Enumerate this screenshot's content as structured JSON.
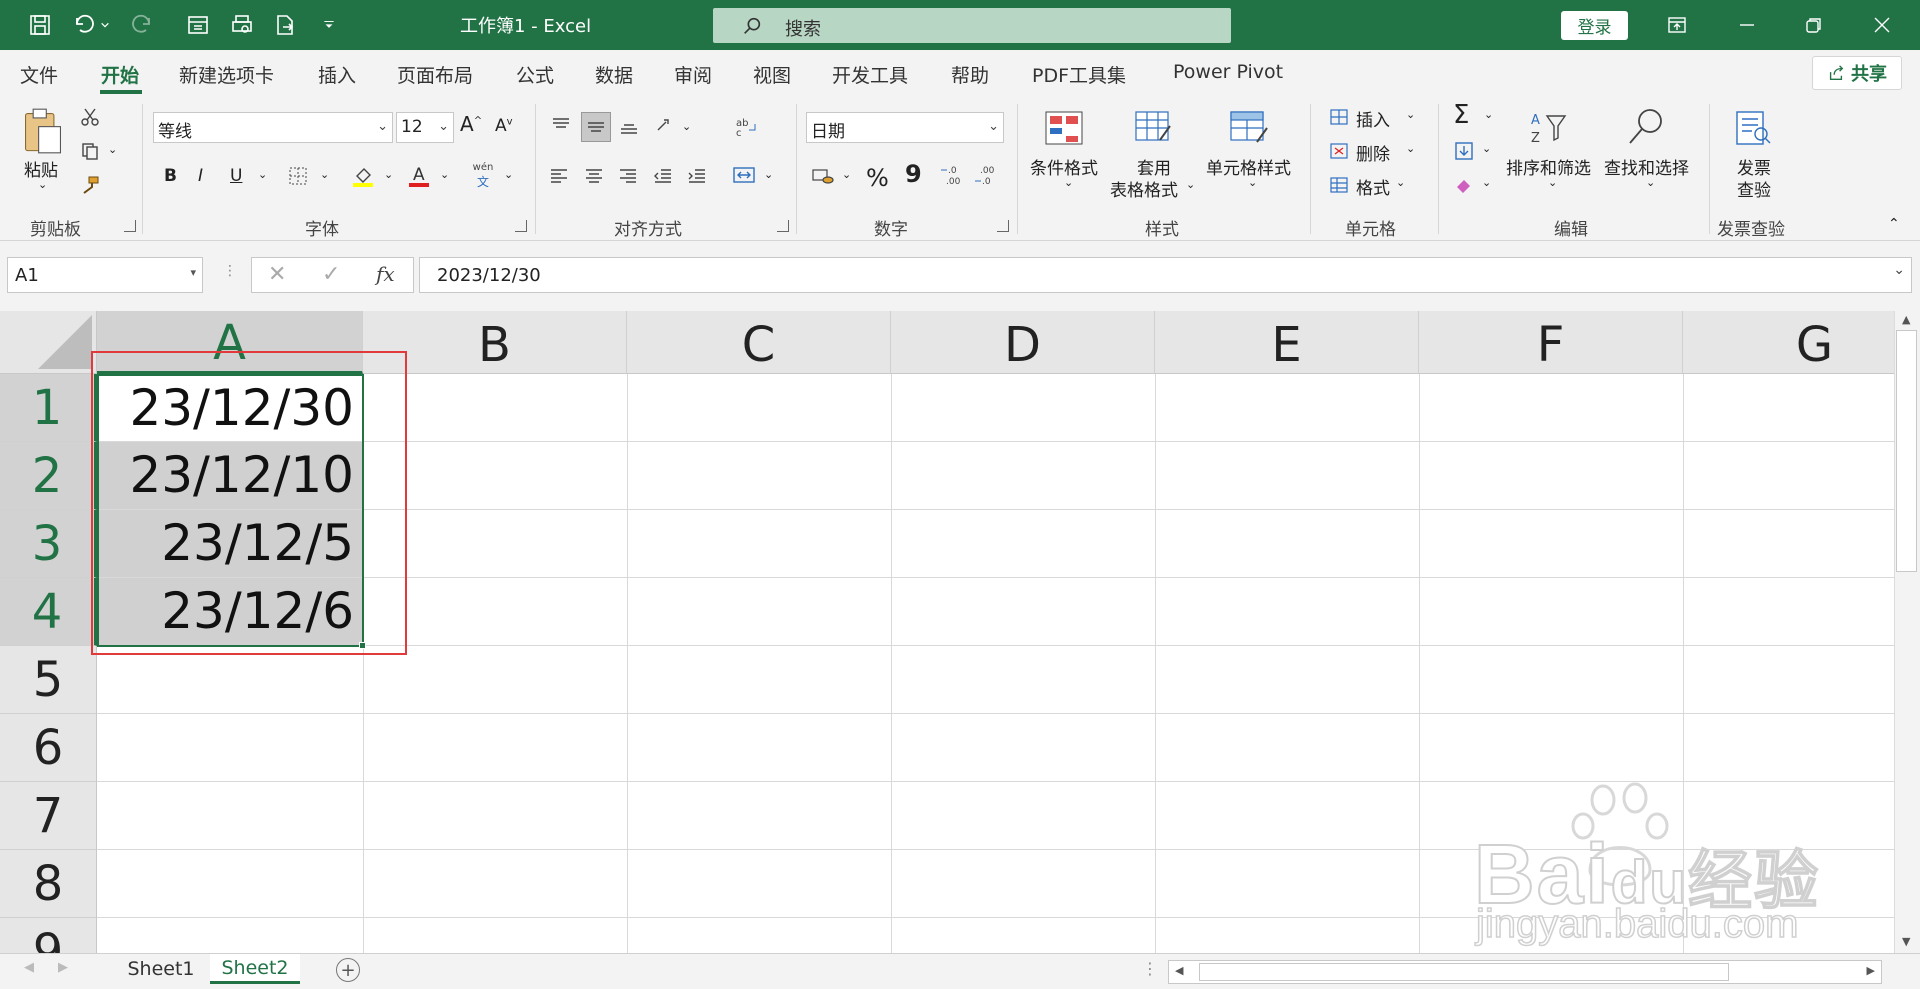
{
  "titlebar": {
    "doc_title": "工作簿1  -  Excel",
    "search_placeholder": "搜索",
    "login_label": "登录"
  },
  "menu": {
    "items": [
      "文件",
      "开始",
      "新建选项卡",
      "插入",
      "页面布局",
      "公式",
      "数据",
      "审阅",
      "视图",
      "开发工具",
      "帮助",
      "PDF工具集",
      "Power Pivot"
    ],
    "active": "开始",
    "share_label": "共享"
  },
  "ribbon": {
    "clipboard": {
      "label": "剪贴板",
      "paste_label": "粘贴"
    },
    "font": {
      "label": "字体",
      "font_name": "等线",
      "font_size": "12",
      "bold": "B",
      "italic": "I",
      "underline": "U",
      "phonetic_top": "wén",
      "phonetic_bottom": "文"
    },
    "alignment": {
      "label": "对齐方式"
    },
    "number": {
      "label": "数字",
      "format": "日期",
      "percent": "%",
      "comma": "9"
    },
    "styles": {
      "label": "样式",
      "conditional": "条件格式",
      "table_format_1": "套用",
      "table_format_2": "表格格式",
      "cell_styles": "单元格样式"
    },
    "cells": {
      "label": "单元格",
      "insert": "插入",
      "delete": "删除",
      "format": "格式"
    },
    "editing": {
      "label": "编辑",
      "sort_filter": "排序和筛选",
      "find_select": "查找和选择"
    },
    "invoice": {
      "label": "发票查验",
      "btn_line1": "发票",
      "btn_line2": "查验"
    }
  },
  "formula_bar": {
    "name_box": "A1",
    "fx": "fx",
    "formula": "2023/12/30"
  },
  "grid": {
    "columns": [
      "A",
      "B",
      "C",
      "D",
      "E",
      "F",
      "G"
    ],
    "rows": [
      "1",
      "2",
      "3",
      "4",
      "5",
      "6",
      "7",
      "8",
      "9"
    ],
    "cells": [
      "23/12/30",
      "23/12/10",
      "23/12/5",
      "23/12/6"
    ]
  },
  "sheets": {
    "tabs": [
      "Sheet1",
      "Sheet2"
    ],
    "active": "Sheet2"
  },
  "watermark": {
    "brand": "Bai",
    "brand2": "du",
    "suffix": "经验",
    "url": "jingyan.baidu.com"
  },
  "colors": {
    "accent": "#217346",
    "highlight": "#e23a3a"
  }
}
